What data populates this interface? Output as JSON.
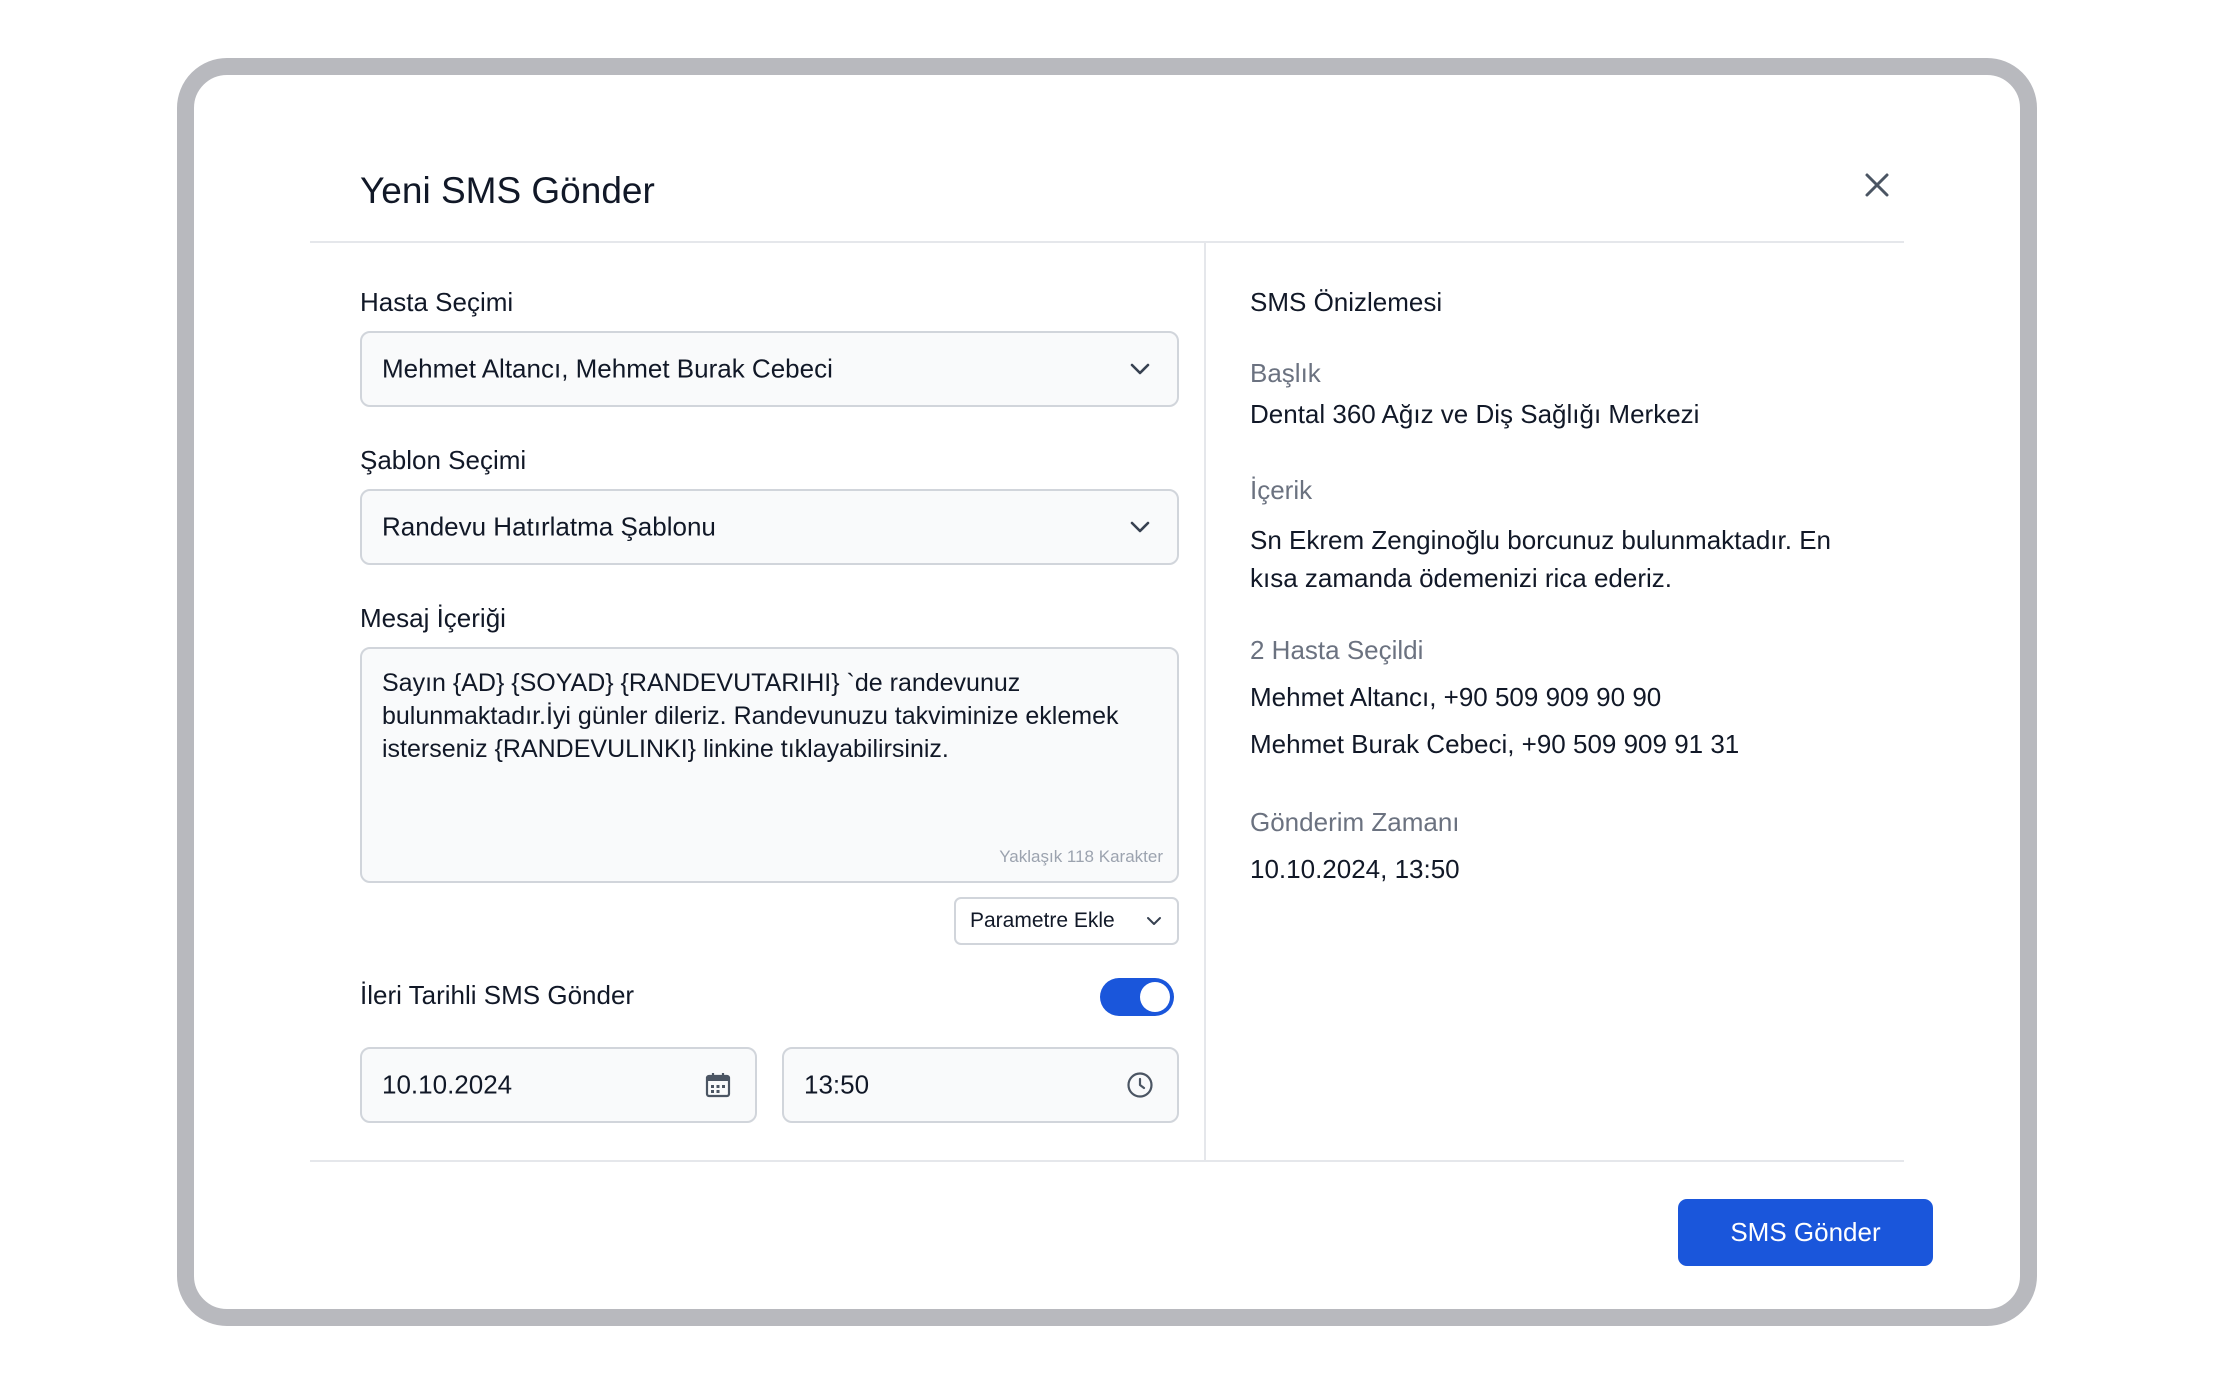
{
  "modal": {
    "title": "Yeni SMS Gönder"
  },
  "form": {
    "patient_label": "Hasta Seçimi",
    "patient_value": "Mehmet Altancı, Mehmet Burak Cebeci",
    "template_label": "Şablon Seçimi",
    "template_value": "Randevu Hatırlatma Şablonu",
    "message_label": "Mesaj İçeriği",
    "message_value": "Sayın {AD}  {SOYAD}  {RANDEVUTARIHI}  `de randevunuz bulunmaktadır.İyi günler dileriz. Randevunuzu takviminize eklemek isterseniz  {RANDEVULINKI} linkine tıklayabilirsiniz.",
    "char_count": "Yaklaşık 118 Karakter",
    "param_button": "Parametre Ekle",
    "schedule_label": "İleri Tarihli SMS Gönder",
    "schedule_enabled": true,
    "date_value": "10.10.2024",
    "time_value": "13:50"
  },
  "preview": {
    "heading": "SMS Önizlemesi",
    "title_label": "Başlık",
    "title_value": "Dental 360 Ağız ve Diş Sağlığı Merkezi",
    "content_label": "İçerik",
    "content_value": "Sn Ekrem Zenginoğlu borcunuz bulunmaktadır. En kısa zamanda ödemenizi rica ederiz.",
    "recipients_label": "2 Hasta Seçildi",
    "recipients": [
      "Mehmet Altancı, +90 509 909 90 90",
      "Mehmet Burak Cebeci, +90 509 909 91 31"
    ],
    "send_time_label": "Gönderim Zamanı",
    "send_time_value": "10.10.2024, 13:50"
  },
  "footer": {
    "send_button": "SMS Gönder"
  },
  "colors": {
    "accent": "#1a56db",
    "frame": "#b8b9be"
  },
  "icons": [
    "close-icon",
    "chevron-down-icon",
    "calendar-icon",
    "clock-icon"
  ]
}
